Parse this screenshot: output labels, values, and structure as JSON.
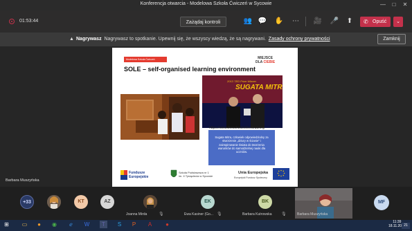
{
  "window": {
    "title": "Konferencja otwarcia - Modelowa Szkoła Ćwiczeń w Sycowie",
    "minimize": "—",
    "maximize": "□",
    "close": "✕"
  },
  "toolbar": {
    "timer": "01:53:44",
    "manage_controls": "Zażądaj kontroli",
    "leave": "Opuść",
    "leave_chevron": "⌄",
    "icons": {
      "participants": "👥",
      "chat": "💬",
      "raise_hand": "✋",
      "more": "⋯",
      "camera": "🎥",
      "mic": "🎤",
      "share": "⬆"
    }
  },
  "banner": {
    "label": "Nagrywasz",
    "message": "Nagrywasz to spotkanie. Upewnij się, że wszyscy wiedzą, że są nagrywani.",
    "link": "Zasady ochrony prywatności",
    "close_button": "Zamknij"
  },
  "slide": {
    "school_logo": "Modelowa Szkoła Ćwiczeń",
    "title": "SOLE – self-organised learning environment",
    "brand_line1": "MIEJSCE",
    "brand_line2a": "DLA",
    "brand_line2b": "CIEBIE",
    "sugata_title": "SUGATA MITRA",
    "sugata_sub": "2013 TED Prize Winner",
    "url": "https://www.theschoolinthecloud.org",
    "blue_box": "Sugata Mitra, człowiek odpowiedzialny za stworzenie „dziury w ścianie\" i zainspirowanie świata do tworzenia warunków do samodzielnej nauki dla uczniów.",
    "footer_fe_line1": "Fundusze",
    "footer_fe_line2": "Europejskie",
    "footer_school_line1": "Szkoła Podstawowa nr 1",
    "footer_school_line2": "im. II Tysiąclecia w Sycowie",
    "footer_ue": "Unia Europejska",
    "footer_ue_sub": "Europejski Fundusz Społeczny"
  },
  "stage": {
    "presenter_name": "Barbara Muszyńska"
  },
  "participants": [
    {
      "initials": "+33",
      "name": "",
      "color": "#2a3a66"
    },
    {
      "initials": "",
      "name": "",
      "color": "#7a6a5a"
    },
    {
      "initials": "KT",
      "name": "",
      "color": "#f2c9a8"
    },
    {
      "initials": "AZ",
      "name": "",
      "color": "#d7d7d7"
    },
    {
      "initials": "",
      "name": "Joanna Mirda",
      "color": "#8a6a50"
    },
    {
      "initials": "EK",
      "name": "Ewa Kasiner (Go...",
      "color": "#b8d8d0"
    },
    {
      "initials": "BK",
      "name": "Barbara Kutrowska",
      "color": "#cdd9a6"
    },
    {
      "initials": "",
      "name": "Barbara Muszyńska",
      "color": "#4a4a4a"
    },
    {
      "initials": "MF",
      "name": "",
      "color": "#c9daf0"
    }
  ],
  "taskbar": {
    "time": "11:39",
    "date": "18.11.2020",
    "notification_count": "21"
  },
  "colors": {
    "accent_red": "#c4314b",
    "slide_blue": "#4b6cc6",
    "taskbar": "#1b2a44"
  }
}
